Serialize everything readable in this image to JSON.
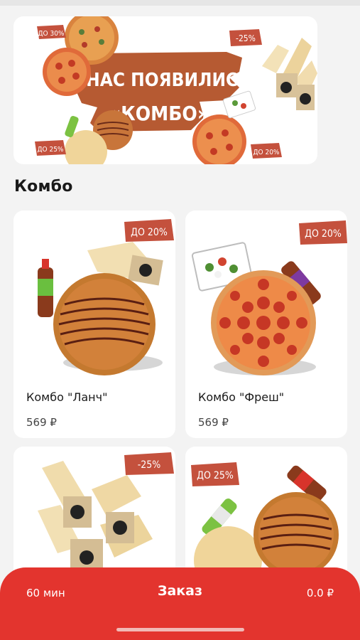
{
  "banner": {
    "headline_line1": "У НАС ПОЯВИЛИСЬ",
    "headline_line2": "«КОМБО»",
    "badge_top_left": "ДО 30%",
    "badge_top_right": "-25%",
    "badge_bottom_left": "ДО 25%",
    "badge_bottom_right": "ДО 20%"
  },
  "section": {
    "title": "Комбо"
  },
  "products": [
    {
      "name": "Комбо \"Ланч\"",
      "price": "569 ₽",
      "badge": "ДО 20%"
    },
    {
      "name": "Комбо \"Фреш\"",
      "price": "569 ₽",
      "badge": "ДО 20%"
    },
    {
      "name": "",
      "price": "",
      "badge": "-25%"
    },
    {
      "name": "",
      "price": "",
      "badge": "ДО 25%"
    }
  ],
  "order_bar": {
    "time": "60 мин",
    "label": "Заказ",
    "total": "0.0 ₽"
  },
  "colors": {
    "accent": "#e3342e",
    "badge": "#c4513d",
    "background": "#f3f3f3"
  }
}
